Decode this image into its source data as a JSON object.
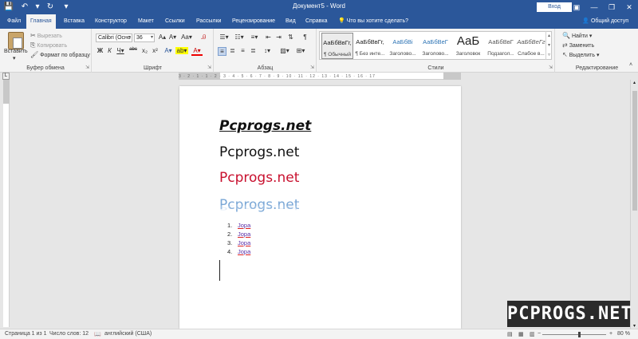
{
  "window": {
    "title": "Документ5 - Word",
    "signin_label": "Вход",
    "minimize_glyph": "—",
    "restore_glyph": "❐",
    "close_glyph": "✕",
    "ribbon_display_glyph": "▣"
  },
  "qat": {
    "save_glyph": "💾",
    "undo_glyph": "↶",
    "undo_dropdown_glyph": "▾",
    "redo_glyph": "↻",
    "customize_glyph": "▾"
  },
  "tabs": [
    {
      "label": "Файл"
    },
    {
      "label": "Главная"
    },
    {
      "label": "Вставка"
    },
    {
      "label": "Конструктор"
    },
    {
      "label": "Макет"
    },
    {
      "label": "Ссылки"
    },
    {
      "label": "Рассылки"
    },
    {
      "label": "Рецензирование"
    },
    {
      "label": "Вид"
    },
    {
      "label": "Справка"
    }
  ],
  "tell_me": {
    "glyph": "💡",
    "label": "Что вы хотите сделать?"
  },
  "share": {
    "glyph": "👤",
    "label": "Общий доступ"
  },
  "ribbon": {
    "clipboard": {
      "label": "Буфер обмена",
      "paste_label": "Вставить",
      "paste_dropdown_glyph": "▾",
      "cut_glyph": "✂",
      "cut_label": "Вырезать",
      "copy_glyph": "⎘",
      "copy_label": "Копировать",
      "format_painter_glyph": "🖌",
      "format_painter_label": "Формат по образцу",
      "launcher_glyph": "⇲"
    },
    "font": {
      "label": "Шрифт",
      "font_name": "Calibri (Осно",
      "font_size": "36",
      "combo_arrow_glyph": "▾",
      "launcher_glyph": "⇲",
      "tools": [
        "A▴",
        "A▾",
        "Aa▾",
        "Ꭿ",
        "Ж",
        "К",
        "Ч▾",
        "abc",
        "x₂",
        "x²",
        "A▾",
        "ab▾",
        "A▾"
      ]
    },
    "paragraph": {
      "label": "Абзац",
      "launcher_glyph": "⇲",
      "tools": [
        "☰▾",
        "☷▾",
        "≡▾",
        "⇤",
        "⇥",
        "⇅",
        "¶",
        "≡",
        "≣",
        "≡",
        "≣",
        "↕▾",
        "▨▾",
        "⊞▾"
      ]
    },
    "styles": {
      "label": "Стили",
      "launcher_glyph": "⇲",
      "scroll_glyphs": [
        "▴",
        "▾",
        "▿"
      ],
      "items": [
        {
          "sample": "АаБбВвГг,",
          "name": "¶ Обычный"
        },
        {
          "sample": "АаБбВвГг,",
          "name": "¶ Без инте..."
        },
        {
          "sample": "АаБбВі",
          "name": "Заголово..."
        },
        {
          "sample": "АаБбВеГ",
          "name": "Заголово..."
        },
        {
          "sample": "АаБ",
          "name": "Заголовок"
        },
        {
          "sample": "АаБбВвГ",
          "name": "Подзагол..."
        },
        {
          "sample": "АаБбВеГг",
          "name": "Слабое в..."
        }
      ]
    },
    "editing": {
      "label": "Редактирование",
      "find_glyph": "🔍",
      "find_label": "Найти ▾",
      "replace_glyph": "⇄",
      "replace_label": "Заменить",
      "select_glyph": "↖",
      "select_label": "Выделить ▾",
      "collapse_glyph": "˄"
    }
  },
  "ruler": {
    "corner_glyph": "L",
    "ticks": "3 · 2 · 1 · 1 · 2 · 3 · 4 · 5 · 6 · 7 · 8 · 9 · 10 · 11 · 12 · 13 · 14 · 15 · 16 · 17"
  },
  "document": {
    "lines": [
      "Pcprogs.net",
      "Pcprogs.net",
      "Pcprogs.net",
      "Pcprogs.net"
    ],
    "list": [
      {
        "num": "1.",
        "text": "Jopa"
      },
      {
        "num": "2.",
        "text": "Jopa"
      },
      {
        "num": "3.",
        "text": "Jopa"
      },
      {
        "num": "4.",
        "text": "Jopa"
      }
    ]
  },
  "colors": {
    "accent": "#2b579a",
    "red_text": "#c8102e",
    "blue_text": "#7aa7d6"
  },
  "watermark": {
    "text": "PCPROGS.NET"
  },
  "scrollbar": {
    "up_glyph": "▴",
    "down_glyph": "▾"
  },
  "status": {
    "page": "Страница 1 из 1",
    "words": "Число слов: 12",
    "proofing_glyph": "📖",
    "language": "английский (США)",
    "view_glyphs": [
      "▤",
      "▦",
      "▥"
    ],
    "zoom_out_glyph": "−",
    "zoom_in_glyph": "+",
    "zoom": "80 %"
  }
}
